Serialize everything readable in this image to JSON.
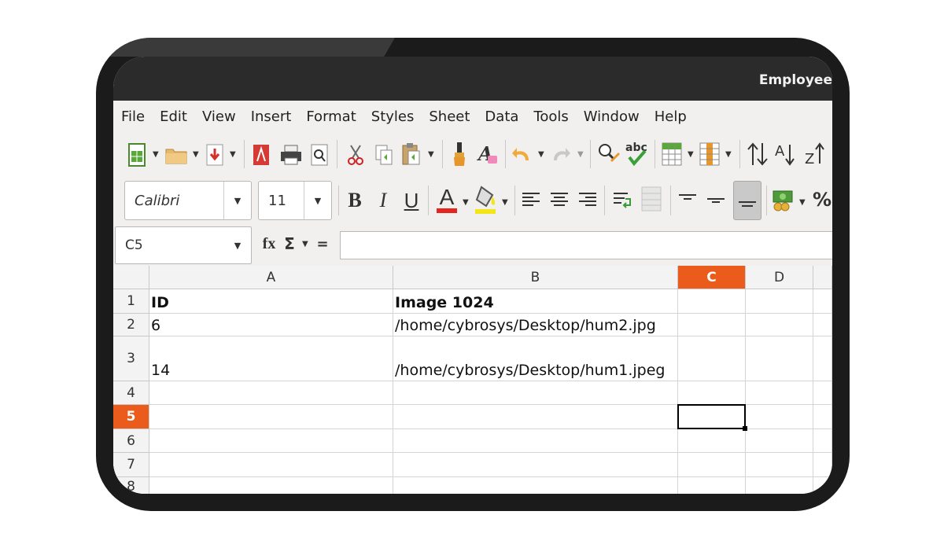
{
  "window": {
    "title": "Employee"
  },
  "menu": [
    "File",
    "Edit",
    "View",
    "Insert",
    "Format",
    "Styles",
    "Sheet",
    "Data",
    "Tools",
    "Window",
    "Help"
  ],
  "toolbar": {
    "font_name": "Calibri",
    "font_size": "11",
    "bold_label": "B",
    "italic_label": "I",
    "underline_label": "U",
    "font_color_label": "A",
    "percent_label": "%",
    "font_color": "#e3271f",
    "highlight_color": "#f2e51a"
  },
  "formula_bar": {
    "name_box": "C5",
    "fx_label": "fx",
    "sum_label": "Σ",
    "equals_label": "=",
    "formula": ""
  },
  "sheet": {
    "columns": [
      "A",
      "B",
      "C",
      "D"
    ],
    "active_column": "C",
    "active_row": "5",
    "rows": [
      {
        "num": "1",
        "A": "ID",
        "B": "Image 1024",
        "C": "",
        "D": ""
      },
      {
        "num": "2",
        "A": "6",
        "B": "/home/cybrosys/Desktop/hum2.jpg",
        "C": "",
        "D": ""
      },
      {
        "num": "3",
        "A": "14",
        "B": "/home/cybrosys/Desktop/hum1.jpeg",
        "C": "",
        "D": ""
      },
      {
        "num": "4",
        "A": "",
        "B": "",
        "C": "",
        "D": ""
      },
      {
        "num": "5",
        "A": "",
        "B": "",
        "C": "",
        "D": ""
      },
      {
        "num": "6",
        "A": "",
        "B": "",
        "C": "",
        "D": ""
      },
      {
        "num": "7",
        "A": "",
        "B": "",
        "C": "",
        "D": ""
      },
      {
        "num": "8",
        "A": "",
        "B": "",
        "C": "",
        "D": ""
      }
    ]
  },
  "accent_color": "#ea5b1c"
}
